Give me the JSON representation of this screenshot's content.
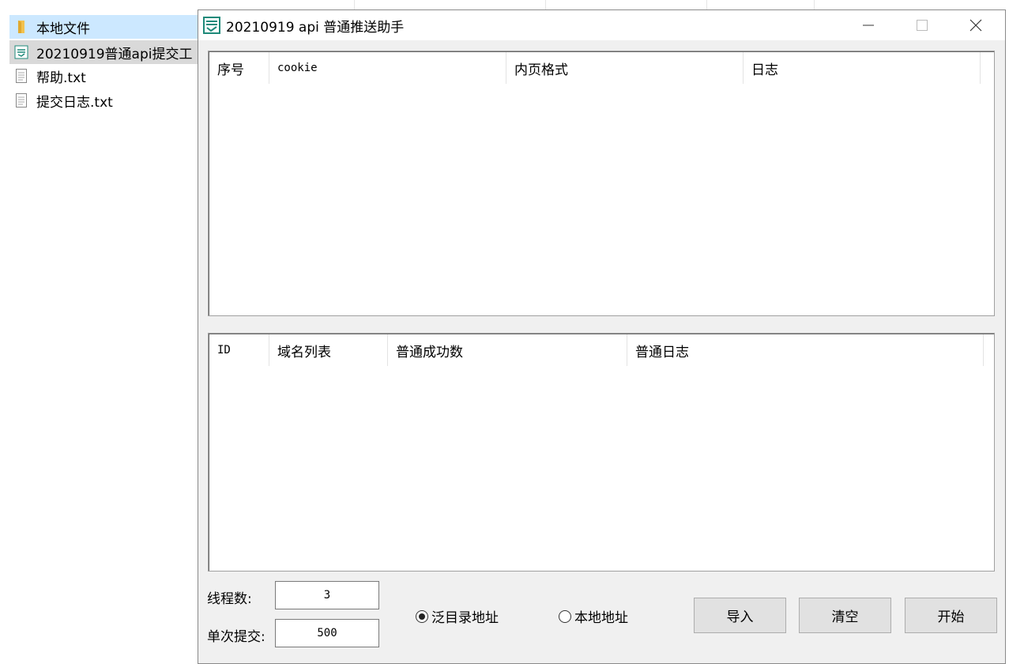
{
  "explorer": {
    "files": [
      {
        "name": "本地文件",
        "icon": "folder-icon"
      },
      {
        "name": "20210919普通api提交工",
        "icon": "app-icon"
      },
      {
        "name": "帮助.txt",
        "icon": "text-file-icon"
      },
      {
        "name": "提交日志.txt",
        "icon": "text-file-icon"
      }
    ]
  },
  "window": {
    "title": "20210919 api 普通推送助手",
    "icon": "app-logo-icon",
    "controls": {
      "minimize": "minimize-icon",
      "maximize": "maximize-icon",
      "close": "close-icon"
    }
  },
  "top_list": {
    "columns": [
      "序号",
      "cookie",
      "内页格式",
      "日志"
    ],
    "rows": []
  },
  "bottom_list": {
    "columns": [
      "ID",
      "域名列表",
      "普通成功数",
      "普通日志"
    ],
    "rows": []
  },
  "controls": {
    "threads_label": "线程数:",
    "threads_value": "3",
    "batch_label": "单次提交:",
    "batch_value": "500",
    "radio_generic": "泛目录地址",
    "radio_local": "本地地址",
    "radio_selected": "泛目录地址",
    "import_button": "导入",
    "clear_button": "清空",
    "start_button": "开始"
  },
  "colors": {
    "window_bg": "#f0f0f0",
    "list_bg": "#ffffff",
    "button_bg": "#e1e1e1",
    "app_icon": "#1f8a7a",
    "folder": "#f2c14e"
  }
}
